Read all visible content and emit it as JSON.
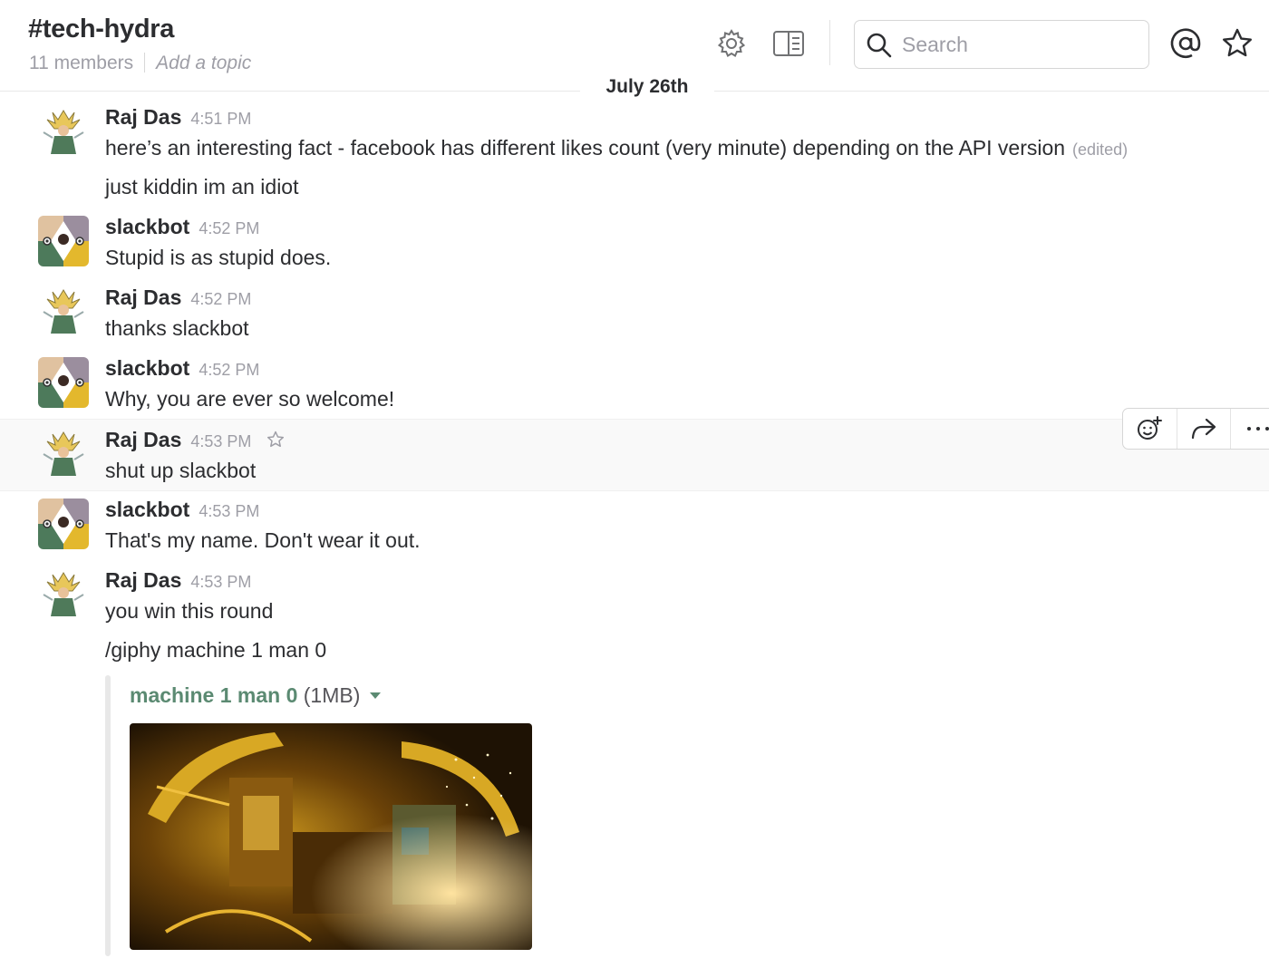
{
  "channel": {
    "name": "#tech-hydra",
    "members": "11 members",
    "topic_placeholder": "Add a topic"
  },
  "header_icons": [
    "gear-icon",
    "sidebar-toggle-icon",
    "search-icon",
    "at-mention-icon",
    "star-icon"
  ],
  "search": {
    "placeholder": "Search"
  },
  "day_divider": "July 26th",
  "messages": [
    {
      "sender": "Raj Das",
      "time": "4:51 PM",
      "lines": [
        "here’s an interesting fact - facebook has different likes count (very minute) depending on the API version",
        "just kiddin im an idiot"
      ],
      "edited": "(edited)"
    },
    {
      "sender": "slackbot",
      "time": "4:52 PM",
      "lines": [
        "Stupid is as stupid does."
      ]
    },
    {
      "sender": "Raj Das",
      "time": "4:52 PM",
      "lines": [
        "thanks slackbot"
      ]
    },
    {
      "sender": "slackbot",
      "time": "4:52 PM",
      "lines": [
        "Why, you are ever so welcome!"
      ]
    },
    {
      "sender": "Raj Das",
      "time": "4:53 PM",
      "lines": [
        "shut up slackbot"
      ]
    },
    {
      "sender": "slackbot",
      "time": "4:53 PM",
      "lines": [
        "That's my name. Don't wear it out."
      ]
    },
    {
      "sender": "Raj Das",
      "time": "4:53 PM",
      "lines": [
        "you win this round",
        "/giphy machine 1 man 0"
      ]
    }
  ],
  "attachment": {
    "title": "machine 1 man 0",
    "size": "(1MB)"
  },
  "message_actions": [
    "add-reaction-icon",
    "share-icon",
    "more-actions-icon"
  ],
  "colors": {
    "link_green": "#5b8a72",
    "text": "#2c2d30",
    "muted": "#9e9ea6"
  }
}
